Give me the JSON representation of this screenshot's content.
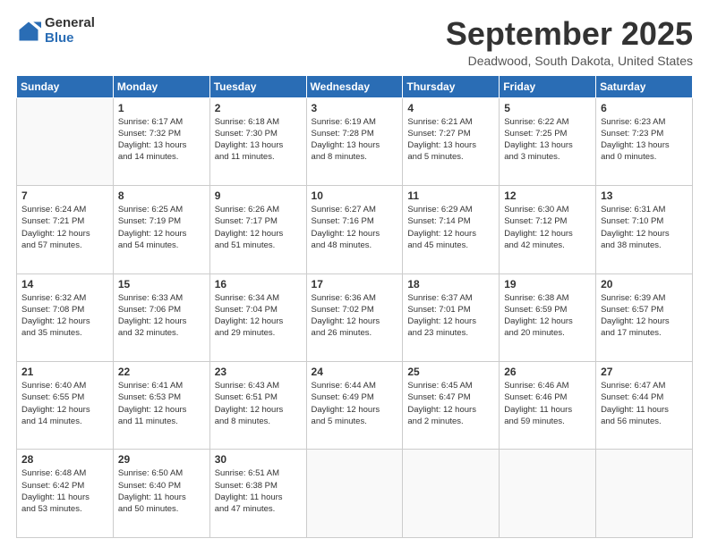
{
  "logo": {
    "general": "General",
    "blue": "Blue"
  },
  "header": {
    "month": "September 2025",
    "location": "Deadwood, South Dakota, United States"
  },
  "weekdays": [
    "Sunday",
    "Monday",
    "Tuesday",
    "Wednesday",
    "Thursday",
    "Friday",
    "Saturday"
  ],
  "weeks": [
    [
      {
        "day": "",
        "info": ""
      },
      {
        "day": "1",
        "info": "Sunrise: 6:17 AM\nSunset: 7:32 PM\nDaylight: 13 hours\nand 14 minutes."
      },
      {
        "day": "2",
        "info": "Sunrise: 6:18 AM\nSunset: 7:30 PM\nDaylight: 13 hours\nand 11 minutes."
      },
      {
        "day": "3",
        "info": "Sunrise: 6:19 AM\nSunset: 7:28 PM\nDaylight: 13 hours\nand 8 minutes."
      },
      {
        "day": "4",
        "info": "Sunrise: 6:21 AM\nSunset: 7:27 PM\nDaylight: 13 hours\nand 5 minutes."
      },
      {
        "day": "5",
        "info": "Sunrise: 6:22 AM\nSunset: 7:25 PM\nDaylight: 13 hours\nand 3 minutes."
      },
      {
        "day": "6",
        "info": "Sunrise: 6:23 AM\nSunset: 7:23 PM\nDaylight: 13 hours\nand 0 minutes."
      }
    ],
    [
      {
        "day": "7",
        "info": "Sunrise: 6:24 AM\nSunset: 7:21 PM\nDaylight: 12 hours\nand 57 minutes."
      },
      {
        "day": "8",
        "info": "Sunrise: 6:25 AM\nSunset: 7:19 PM\nDaylight: 12 hours\nand 54 minutes."
      },
      {
        "day": "9",
        "info": "Sunrise: 6:26 AM\nSunset: 7:17 PM\nDaylight: 12 hours\nand 51 minutes."
      },
      {
        "day": "10",
        "info": "Sunrise: 6:27 AM\nSunset: 7:16 PM\nDaylight: 12 hours\nand 48 minutes."
      },
      {
        "day": "11",
        "info": "Sunrise: 6:29 AM\nSunset: 7:14 PM\nDaylight: 12 hours\nand 45 minutes."
      },
      {
        "day": "12",
        "info": "Sunrise: 6:30 AM\nSunset: 7:12 PM\nDaylight: 12 hours\nand 42 minutes."
      },
      {
        "day": "13",
        "info": "Sunrise: 6:31 AM\nSunset: 7:10 PM\nDaylight: 12 hours\nand 38 minutes."
      }
    ],
    [
      {
        "day": "14",
        "info": "Sunrise: 6:32 AM\nSunset: 7:08 PM\nDaylight: 12 hours\nand 35 minutes."
      },
      {
        "day": "15",
        "info": "Sunrise: 6:33 AM\nSunset: 7:06 PM\nDaylight: 12 hours\nand 32 minutes."
      },
      {
        "day": "16",
        "info": "Sunrise: 6:34 AM\nSunset: 7:04 PM\nDaylight: 12 hours\nand 29 minutes."
      },
      {
        "day": "17",
        "info": "Sunrise: 6:36 AM\nSunset: 7:02 PM\nDaylight: 12 hours\nand 26 minutes."
      },
      {
        "day": "18",
        "info": "Sunrise: 6:37 AM\nSunset: 7:01 PM\nDaylight: 12 hours\nand 23 minutes."
      },
      {
        "day": "19",
        "info": "Sunrise: 6:38 AM\nSunset: 6:59 PM\nDaylight: 12 hours\nand 20 minutes."
      },
      {
        "day": "20",
        "info": "Sunrise: 6:39 AM\nSunset: 6:57 PM\nDaylight: 12 hours\nand 17 minutes."
      }
    ],
    [
      {
        "day": "21",
        "info": "Sunrise: 6:40 AM\nSunset: 6:55 PM\nDaylight: 12 hours\nand 14 minutes."
      },
      {
        "day": "22",
        "info": "Sunrise: 6:41 AM\nSunset: 6:53 PM\nDaylight: 12 hours\nand 11 minutes."
      },
      {
        "day": "23",
        "info": "Sunrise: 6:43 AM\nSunset: 6:51 PM\nDaylight: 12 hours\nand 8 minutes."
      },
      {
        "day": "24",
        "info": "Sunrise: 6:44 AM\nSunset: 6:49 PM\nDaylight: 12 hours\nand 5 minutes."
      },
      {
        "day": "25",
        "info": "Sunrise: 6:45 AM\nSunset: 6:47 PM\nDaylight: 12 hours\nand 2 minutes."
      },
      {
        "day": "26",
        "info": "Sunrise: 6:46 AM\nSunset: 6:46 PM\nDaylight: 11 hours\nand 59 minutes."
      },
      {
        "day": "27",
        "info": "Sunrise: 6:47 AM\nSunset: 6:44 PM\nDaylight: 11 hours\nand 56 minutes."
      }
    ],
    [
      {
        "day": "28",
        "info": "Sunrise: 6:48 AM\nSunset: 6:42 PM\nDaylight: 11 hours\nand 53 minutes."
      },
      {
        "day": "29",
        "info": "Sunrise: 6:50 AM\nSunset: 6:40 PM\nDaylight: 11 hours\nand 50 minutes."
      },
      {
        "day": "30",
        "info": "Sunrise: 6:51 AM\nSunset: 6:38 PM\nDaylight: 11 hours\nand 47 minutes."
      },
      {
        "day": "",
        "info": ""
      },
      {
        "day": "",
        "info": ""
      },
      {
        "day": "",
        "info": ""
      },
      {
        "day": "",
        "info": ""
      }
    ]
  ]
}
